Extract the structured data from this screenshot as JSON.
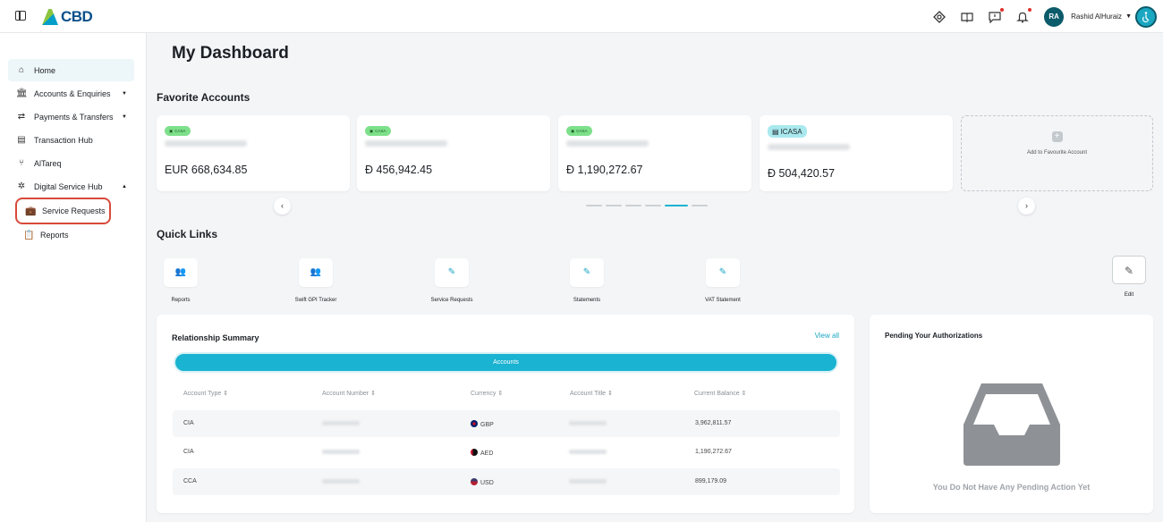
{
  "header": {
    "logo_text": "CBD",
    "user_initials": "RA",
    "user_name": "Rashid AlHuraiz"
  },
  "sidebar": {
    "items": [
      {
        "label": "Home"
      },
      {
        "label": "Accounts & Enquiries"
      },
      {
        "label": "Payments & Transfers"
      },
      {
        "label": "Transaction Hub"
      },
      {
        "label": "AlTareq"
      },
      {
        "label": "Digital Service Hub"
      }
    ],
    "sub_items": [
      {
        "label": "Service Requests"
      },
      {
        "label": "Reports"
      }
    ]
  },
  "main": {
    "title": "My Dashboard",
    "favorites": {
      "title": "Favorite Accounts",
      "cards": [
        {
          "badge": "CASA",
          "amount": "EUR 668,634.85"
        },
        {
          "badge": "CASA",
          "amount": "Đ 456,942.45"
        },
        {
          "badge": "CASA",
          "amount": "Đ 1,190,272.67"
        },
        {
          "badge": "ICASA",
          "amount": "Đ 504,420.57"
        }
      ],
      "add_label": "Add to Favourite Account"
    },
    "quick_links": {
      "title": "Quick Links",
      "items": [
        {
          "label": "Reports"
        },
        {
          "label": "Swift GPI Tracker"
        },
        {
          "label": "Service Requests"
        },
        {
          "label": "Statements"
        },
        {
          "label": "VAT Statement"
        }
      ],
      "edit_label": "Edit"
    },
    "relationship": {
      "title": "Relationship Summary",
      "view_all": "View all",
      "tab": "Accounts",
      "columns": [
        "Account Type",
        "Account Number",
        "Currency",
        "Account Title",
        "Current Balance"
      ],
      "rows": [
        {
          "type": "CIA",
          "currency": "GBP",
          "balance": "3,962,811.57"
        },
        {
          "type": "CIA",
          "currency": "AED",
          "balance": "1,190,272.67"
        },
        {
          "type": "CCA",
          "currency": "USD",
          "balance": "899,179.09"
        }
      ]
    },
    "pending": {
      "title": "Pending Your Authorizations",
      "message": "You Do Not Have Any Pending Action Yet"
    }
  },
  "colors": {
    "accent": "#1ab3d1",
    "badge_green": "#7de08a",
    "highlight_red": "#d74a3a"
  }
}
